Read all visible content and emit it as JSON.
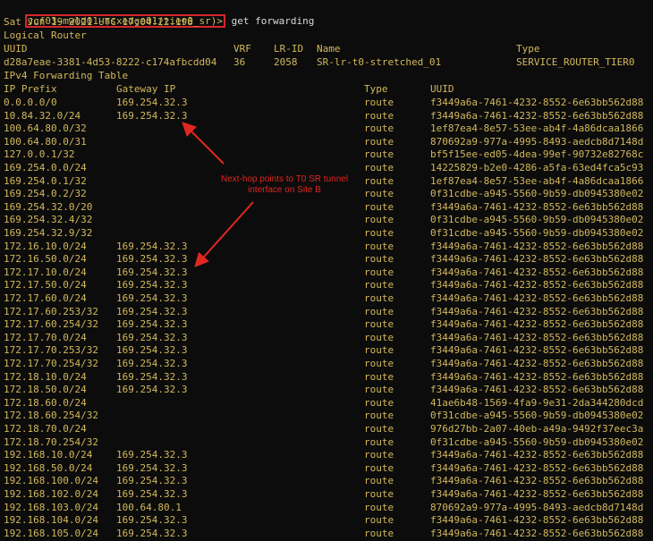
{
  "terminal": {
    "prompt": "vcf03-mwld01-nsxedge01(tier0_sr)>",
    "command": " get forwarding",
    "timestamp": "Sat Jun 19 2021 UTC 17:04:22.198",
    "section_logical_router": "Logical Router",
    "lr_headers": {
      "uuid": "UUID",
      "vrf": "VRF",
      "lrid": "LR-ID",
      "name": "Name",
      "type": "Type"
    },
    "lr_row": {
      "uuid": "d28a7eae-3381-4d53-8222-c174afbcdd04",
      "vrf": "36",
      "lrid": "2058",
      "name": "SR-lr-t0-stretched_01",
      "type": "SERVICE_ROUTER_TIER0"
    },
    "section_fwd_table": "IPv4 Forwarding Table",
    "fwd_headers": {
      "prefix": "IP Prefix",
      "gateway": "Gateway IP",
      "type": "Type",
      "uuid": "UUID"
    },
    "routes": [
      {
        "prefix": "0.0.0.0/0",
        "gateway": "169.254.32.3",
        "type": "route",
        "uuid": "f3449a6a-7461-4232-8552-6e63bb562d88"
      },
      {
        "prefix": "10.84.32.0/24",
        "gateway": "169.254.32.3",
        "type": "route",
        "uuid": "f3449a6a-7461-4232-8552-6e63bb562d88"
      },
      {
        "prefix": "100.64.80.0/32",
        "gateway": "",
        "type": "route",
        "uuid": "1ef87ea4-8e57-53ee-ab4f-4a86dcaa1866"
      },
      {
        "prefix": "100.64.80.0/31",
        "gateway": "",
        "type": "route",
        "uuid": "870692a9-977a-4995-8493-aedcb8d7148d"
      },
      {
        "prefix": "127.0.0.1/32",
        "gateway": "",
        "type": "route",
        "uuid": "bf5f15ee-ed05-4dea-99ef-90732e82768c"
      },
      {
        "prefix": "169.254.0.0/24",
        "gateway": "",
        "type": "route",
        "uuid": "14225829-b2e0-4286-a5fa-63ed4fca5c93"
      },
      {
        "prefix": "169.254.0.1/32",
        "gateway": "",
        "type": "route",
        "uuid": "1ef87ea4-8e57-53ee-ab4f-4a86dcaa1866"
      },
      {
        "prefix": "169.254.0.2/32",
        "gateway": "",
        "type": "route",
        "uuid": "0f31cdbe-a945-5560-9b59-db0945380e02"
      },
      {
        "prefix": "169.254.32.0/20",
        "gateway": "",
        "type": "route",
        "uuid": "f3449a6a-7461-4232-8552-6e63bb562d88"
      },
      {
        "prefix": "169.254.32.4/32",
        "gateway": "",
        "type": "route",
        "uuid": "0f31cdbe-a945-5560-9b59-db0945380e02"
      },
      {
        "prefix": "169.254.32.9/32",
        "gateway": "",
        "type": "route",
        "uuid": "0f31cdbe-a945-5560-9b59-db0945380e02"
      },
      {
        "prefix": "172.16.10.0/24",
        "gateway": "169.254.32.3",
        "type": "route",
        "uuid": "f3449a6a-7461-4232-8552-6e63bb562d88"
      },
      {
        "prefix": "172.16.50.0/24",
        "gateway": "169.254.32.3",
        "type": "route",
        "uuid": "f3449a6a-7461-4232-8552-6e63bb562d88"
      },
      {
        "prefix": "172.17.10.0/24",
        "gateway": "169.254.32.3",
        "type": "route",
        "uuid": "f3449a6a-7461-4232-8552-6e63bb562d88"
      },
      {
        "prefix": "172.17.50.0/24",
        "gateway": "169.254.32.3",
        "type": "route",
        "uuid": "f3449a6a-7461-4232-8552-6e63bb562d88"
      },
      {
        "prefix": "172.17.60.0/24",
        "gateway": "169.254.32.3",
        "type": "route",
        "uuid": "f3449a6a-7461-4232-8552-6e63bb562d88"
      },
      {
        "prefix": "172.17.60.253/32",
        "gateway": "169.254.32.3",
        "type": "route",
        "uuid": "f3449a6a-7461-4232-8552-6e63bb562d88"
      },
      {
        "prefix": "172.17.60.254/32",
        "gateway": "169.254.32.3",
        "type": "route",
        "uuid": "f3449a6a-7461-4232-8552-6e63bb562d88"
      },
      {
        "prefix": "172.17.70.0/24",
        "gateway": "169.254.32.3",
        "type": "route",
        "uuid": "f3449a6a-7461-4232-8552-6e63bb562d88"
      },
      {
        "prefix": "172.17.70.253/32",
        "gateway": "169.254.32.3",
        "type": "route",
        "uuid": "f3449a6a-7461-4232-8552-6e63bb562d88"
      },
      {
        "prefix": "172.17.70.254/32",
        "gateway": "169.254.32.3",
        "type": "route",
        "uuid": "f3449a6a-7461-4232-8552-6e63bb562d88"
      },
      {
        "prefix": "172.18.10.0/24",
        "gateway": "169.254.32.3",
        "type": "route",
        "uuid": "f3449a6a-7461-4232-8552-6e63bb562d88"
      },
      {
        "prefix": "172.18.50.0/24",
        "gateway": "169.254.32.3",
        "type": "route",
        "uuid": "f3449a6a-7461-4232-8552-6e63bb562d88"
      },
      {
        "prefix": "172.18.60.0/24",
        "gateway": "",
        "type": "route",
        "uuid": "41ae6b48-1569-4fa9-9e31-2da344280dcd"
      },
      {
        "prefix": "172.18.60.254/32",
        "gateway": "",
        "type": "route",
        "uuid": "0f31cdbe-a945-5560-9b59-db0945380e02"
      },
      {
        "prefix": "172.18.70.0/24",
        "gateway": "",
        "type": "route",
        "uuid": "976d27bb-2a07-40eb-a49a-9492f37eec3a"
      },
      {
        "prefix": "172.18.70.254/32",
        "gateway": "",
        "type": "route",
        "uuid": "0f31cdbe-a945-5560-9b59-db0945380e02"
      },
      {
        "prefix": "192.168.10.0/24",
        "gateway": "169.254.32.3",
        "type": "route",
        "uuid": "f3449a6a-7461-4232-8552-6e63bb562d88"
      },
      {
        "prefix": "192.168.50.0/24",
        "gateway": "169.254.32.3",
        "type": "route",
        "uuid": "f3449a6a-7461-4232-8552-6e63bb562d88"
      },
      {
        "prefix": "192.168.100.0/24",
        "gateway": "169.254.32.3",
        "type": "route",
        "uuid": "f3449a6a-7461-4232-8552-6e63bb562d88"
      },
      {
        "prefix": "192.168.102.0/24",
        "gateway": "169.254.32.3",
        "type": "route",
        "uuid": "f3449a6a-7461-4232-8552-6e63bb562d88"
      },
      {
        "prefix": "192.168.103.0/24",
        "gateway": "100.64.80.1",
        "type": "route",
        "uuid": "870692a9-977a-4995-8493-aedcb8d7148d"
      },
      {
        "prefix": "192.168.104.0/24",
        "gateway": "169.254.32.3",
        "type": "route",
        "uuid": "f3449a6a-7461-4232-8552-6e63bb562d88"
      },
      {
        "prefix": "192.168.105.0/24",
        "gateway": "169.254.32.3",
        "type": "route",
        "uuid": "f3449a6a-7461-4232-8552-6e63bb562d88"
      }
    ]
  },
  "annotation": {
    "text": "Next-hop points to T0 SR tunnel interface on Site B",
    "color": "#e0271f"
  },
  "colors": {
    "background": "#0c0c0c",
    "text": "#d2b85c",
    "command": "#d9d9d9",
    "highlight_box": "#d8262c"
  }
}
